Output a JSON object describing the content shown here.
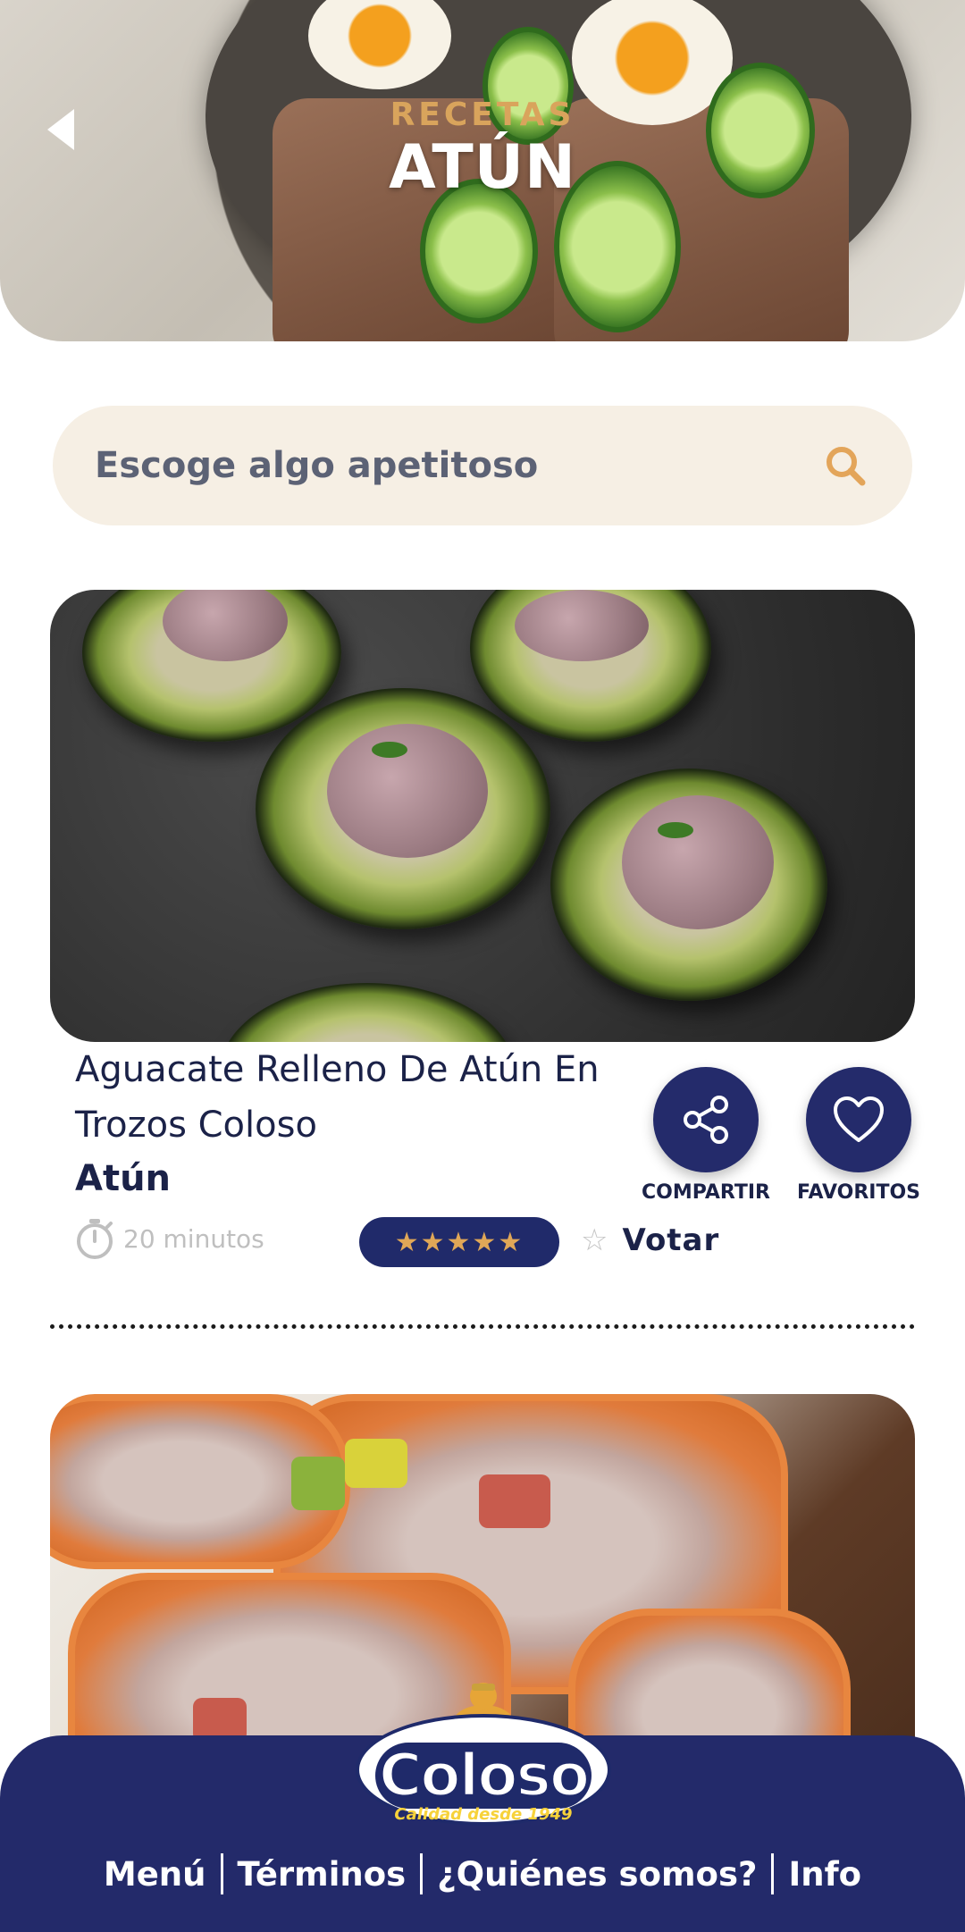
{
  "header": {
    "subtitle": "RECETAS",
    "title": "ATÚN"
  },
  "search": {
    "placeholder": "Escoge algo apetitoso"
  },
  "recipes": [
    {
      "title": "Aguacate Relleno De Atún En Trozos Coloso",
      "category": "Atún",
      "time": "20 minutos",
      "rating_stars": "★★★★★",
      "rating": 5,
      "vote_label": "Votar",
      "share_label": "COMPARTIR",
      "favorites_label": "FAVORITOS"
    }
  ],
  "footer": {
    "logo_word": "Coloso",
    "logo_tagline": "Calidad desde 1949",
    "nav": [
      "Menú",
      "Términos",
      "¿Quiénes somos?",
      "Info"
    ]
  },
  "colors": {
    "navy": "#232a6a",
    "gold": "#d9a45c",
    "search_bg": "#f6efe4"
  }
}
